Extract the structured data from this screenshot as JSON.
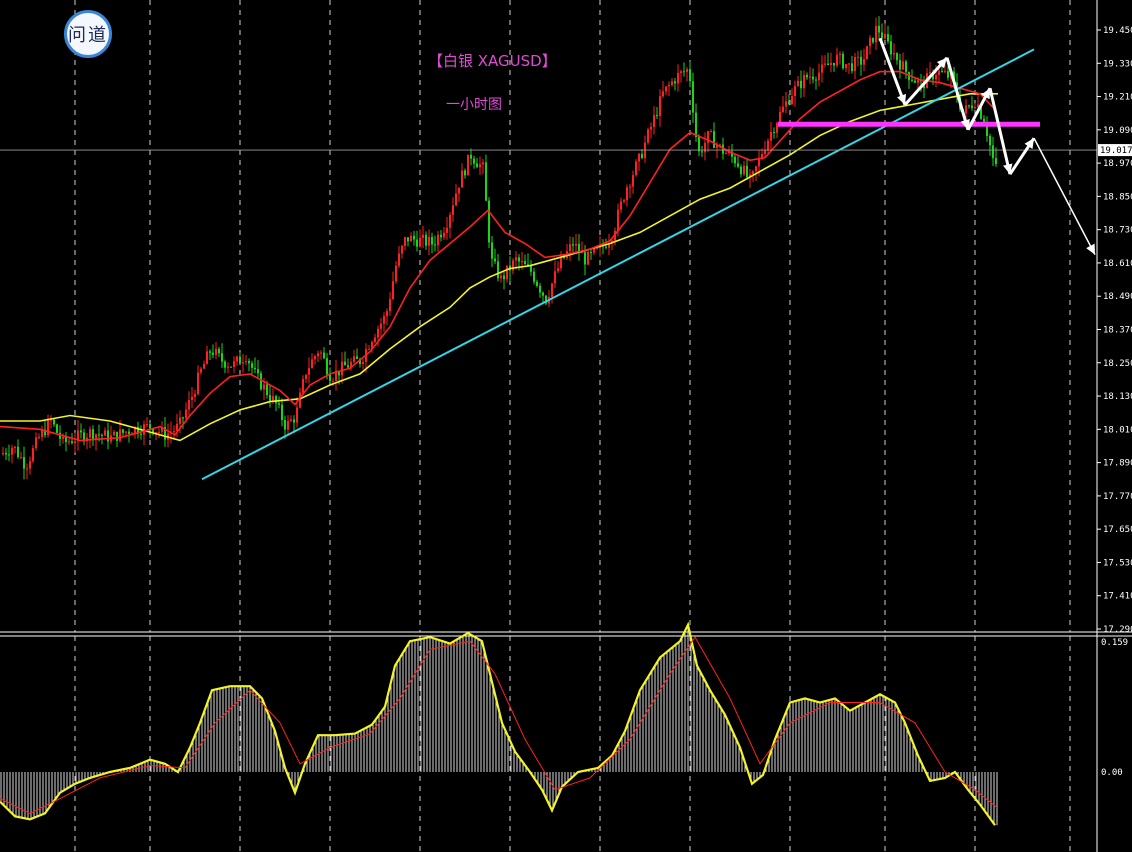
{
  "logo": {
    "text": "问道"
  },
  "chart_data": [
    {
      "type": "candlestick",
      "title": "【白银 XAGUSD】",
      "subtitle": "一小时图",
      "ylim": [
        17.29,
        19.51
      ],
      "yticks": [
        19.45,
        19.33,
        19.21,
        19.09,
        18.97,
        18.85,
        18.73,
        18.61,
        18.49,
        18.37,
        18.25,
        18.13,
        18.01,
        17.89,
        17.77,
        17.65,
        17.53,
        17.41,
        17.29
      ],
      "tick_labels": [
        "19.450",
        "19.330",
        "19.210",
        "19.090",
        "18.970",
        "18.850",
        "18.730",
        "18.610",
        "18.490",
        "18.370",
        "18.250",
        "18.130",
        "18.010",
        "17.890",
        "17.770",
        "17.650",
        "17.530",
        "17.410",
        "17.290"
      ],
      "current_price": 19.017,
      "current_price_label": "19.017",
      "colors": {
        "up": "#ff2020",
        "down": "#19d619",
        "ma_fast": "#ff2020",
        "ma_slow": "#f3f32a",
        "trend": "#33d6e8",
        "support": "#ff33ff",
        "projection": "#ffffff"
      },
      "close_path": [
        [
          0,
          17.92
        ],
        [
          12,
          17.95
        ],
        [
          25,
          17.88
        ],
        [
          38,
          17.98
        ],
        [
          50,
          18.04
        ],
        [
          62,
          17.96
        ],
        [
          75,
          17.98
        ],
        [
          90,
          18.0
        ],
        [
          110,
          17.98
        ],
        [
          130,
          18.01
        ],
        [
          150,
          18.02
        ],
        [
          165,
          17.99
        ],
        [
          178,
          18.02
        ],
        [
          190,
          18.12
        ],
        [
          200,
          18.22
        ],
        [
          210,
          18.3
        ],
        [
          220,
          18.26
        ],
        [
          232,
          18.24
        ],
        [
          245,
          18.28
        ],
        [
          255,
          18.2
        ],
        [
          265,
          18.15
        ],
        [
          275,
          18.1
        ],
        [
          285,
          18.02
        ],
        [
          295,
          18.06
        ],
        [
          305,
          18.22
        ],
        [
          318,
          18.3
        ],
        [
          330,
          18.2
        ],
        [
          345,
          18.24
        ],
        [
          360,
          18.26
        ],
        [
          372,
          18.35
        ],
        [
          385,
          18.42
        ],
        [
          395,
          18.6
        ],
        [
          405,
          18.7
        ],
        [
          420,
          18.69
        ],
        [
          432,
          18.68
        ],
        [
          445,
          18.75
        ],
        [
          458,
          18.9
        ],
        [
          470,
          19.0
        ],
        [
          482,
          18.95
        ],
        [
          490,
          18.62
        ],
        [
          500,
          18.55
        ],
        [
          515,
          18.62
        ],
        [
          530,
          18.58
        ],
        [
          545,
          18.48
        ],
        [
          558,
          18.6
        ],
        [
          572,
          18.68
        ],
        [
          585,
          18.62
        ],
        [
          600,
          18.66
        ],
        [
          612,
          18.72
        ],
        [
          625,
          18.88
        ],
        [
          638,
          18.98
        ],
        [
          650,
          19.1
        ],
        [
          662,
          19.22
        ],
        [
          675,
          19.28
        ],
        [
          688,
          19.31
        ],
        [
          697,
          19.0
        ],
        [
          708,
          19.07
        ],
        [
          720,
          19.02
        ],
        [
          735,
          18.98
        ],
        [
          750,
          18.9
        ],
        [
          762,
          19.02
        ],
        [
          775,
          19.12
        ],
        [
          790,
          19.22
        ],
        [
          805,
          19.28
        ],
        [
          820,
          19.3
        ],
        [
          835,
          19.35
        ],
        [
          848,
          19.32
        ],
        [
          862,
          19.34
        ],
        [
          876,
          19.46
        ],
        [
          890,
          19.38
        ],
        [
          905,
          19.3
        ],
        [
          920,
          19.25
        ],
        [
          935,
          19.3
        ],
        [
          950,
          19.28
        ],
        [
          962,
          19.15
        ],
        [
          975,
          19.2
        ],
        [
          985,
          19.1
        ],
        [
          994,
          18.95
        ]
      ],
      "ma_fast": [
        [
          0,
          18.02
        ],
        [
          40,
          18.01
        ],
        [
          80,
          17.97
        ],
        [
          120,
          17.98
        ],
        [
          160,
          18.02
        ],
        [
          175,
          17.99
        ],
        [
          190,
          18.06
        ],
        [
          210,
          18.14
        ],
        [
          230,
          18.2
        ],
        [
          250,
          18.21
        ],
        [
          265,
          18.18
        ],
        [
          280,
          18.15
        ],
        [
          295,
          18.1
        ],
        [
          310,
          18.17
        ],
        [
          330,
          18.21
        ],
        [
          350,
          18.23
        ],
        [
          370,
          18.29
        ],
        [
          390,
          18.38
        ],
        [
          410,
          18.52
        ],
        [
          430,
          18.62
        ],
        [
          450,
          18.68
        ],
        [
          470,
          18.74
        ],
        [
          488,
          18.8
        ],
        [
          505,
          18.72
        ],
        [
          525,
          18.68
        ],
        [
          545,
          18.63
        ],
        [
          565,
          18.64
        ],
        [
          590,
          18.66
        ],
        [
          610,
          18.69
        ],
        [
          630,
          18.78
        ],
        [
          650,
          18.9
        ],
        [
          670,
          19.02
        ],
        [
          690,
          19.08
        ],
        [
          710,
          19.05
        ],
        [
          730,
          19.01
        ],
        [
          750,
          18.98
        ],
        [
          765,
          18.99
        ],
        [
          780,
          19.05
        ],
        [
          800,
          19.13
        ],
        [
          820,
          19.19
        ],
        [
          840,
          19.23
        ],
        [
          860,
          19.27
        ],
        [
          880,
          19.3
        ],
        [
          900,
          19.3
        ],
        [
          920,
          19.27
        ],
        [
          940,
          19.26
        ],
        [
          960,
          19.24
        ],
        [
          980,
          19.22
        ],
        [
          996,
          19.16
        ]
      ],
      "ma_slow": [
        [
          0,
          18.04
        ],
        [
          40,
          18.04
        ],
        [
          70,
          18.06
        ],
        [
          110,
          18.04
        ],
        [
          150,
          18.0
        ],
        [
          180,
          17.97
        ],
        [
          210,
          18.03
        ],
        [
          240,
          18.08
        ],
        [
          270,
          18.11
        ],
        [
          300,
          18.12
        ],
        [
          330,
          18.17
        ],
        [
          360,
          18.21
        ],
        [
          390,
          18.3
        ],
        [
          420,
          18.38
        ],
        [
          450,
          18.45
        ],
        [
          470,
          18.52
        ],
        [
          490,
          18.56
        ],
        [
          510,
          18.59
        ],
        [
          530,
          18.6
        ],
        [
          550,
          18.62
        ],
        [
          580,
          18.65
        ],
        [
          610,
          18.68
        ],
        [
          640,
          18.72
        ],
        [
          670,
          18.78
        ],
        [
          700,
          18.84
        ],
        [
          730,
          18.88
        ],
        [
          760,
          18.94
        ],
        [
          790,
          19.0
        ],
        [
          820,
          19.07
        ],
        [
          850,
          19.12
        ],
        [
          880,
          19.16
        ],
        [
          910,
          19.18
        ],
        [
          940,
          19.2
        ],
        [
          970,
          19.22
        ],
        [
          998,
          19.22
        ]
      ],
      "trend_line": [
        [
          202,
          17.83
        ],
        [
          1034,
          19.38
        ]
      ],
      "support_level": {
        "price": 19.11,
        "x": [
          778,
          1040
        ]
      },
      "projection_path": [
        [
          880,
          19.42
        ],
        [
          905,
          19.18
        ],
        [
          947,
          19.35
        ],
        [
          968,
          19.09
        ],
        [
          990,
          19.24
        ],
        [
          1010,
          18.93
        ],
        [
          1034,
          19.06
        ],
        [
          1095,
          18.64
        ]
      ],
      "x_gridlines": [
        75,
        150,
        240,
        330,
        420,
        510,
        600,
        690,
        790,
        885,
        975,
        1070
      ]
    },
    {
      "type": "macd",
      "ylim": [
        -0.09,
        0.159
      ],
      "tick_labels": [
        "0.159",
        "0.00"
      ],
      "histogram_path": [
        [
          0,
          -0.05
        ],
        [
          15,
          -0.075
        ],
        [
          30,
          -0.08
        ],
        [
          45,
          -0.07
        ],
        [
          60,
          -0.035
        ],
        [
          75,
          -0.02
        ],
        [
          90,
          -0.01
        ],
        [
          110,
          0.0
        ],
        [
          130,
          0.005
        ],
        [
          150,
          0.015
        ],
        [
          165,
          0.01
        ],
        [
          178,
          0.0
        ],
        [
          190,
          0.03
        ],
        [
          200,
          0.06
        ],
        [
          212,
          0.1
        ],
        [
          230,
          0.105
        ],
        [
          250,
          0.105
        ],
        [
          262,
          0.09
        ],
        [
          275,
          0.05
        ],
        [
          285,
          0.005
        ],
        [
          295,
          -0.035
        ],
        [
          305,
          0.01
        ],
        [
          318,
          0.045
        ],
        [
          335,
          0.045
        ],
        [
          355,
          0.047
        ],
        [
          372,
          0.058
        ],
        [
          385,
          0.08
        ],
        [
          395,
          0.13
        ],
        [
          410,
          0.16
        ],
        [
          430,
          0.165
        ],
        [
          450,
          0.157
        ],
        [
          468,
          0.17
        ],
        [
          482,
          0.16
        ],
        [
          492,
          0.11
        ],
        [
          502,
          0.06
        ],
        [
          515,
          0.025
        ],
        [
          530,
          0.0
        ],
        [
          542,
          -0.03
        ],
        [
          552,
          -0.065
        ],
        [
          562,
          -0.025
        ],
        [
          578,
          0.0
        ],
        [
          598,
          0.005
        ],
        [
          612,
          0.02
        ],
        [
          625,
          0.05
        ],
        [
          640,
          0.1
        ],
        [
          660,
          0.14
        ],
        [
          680,
          0.16
        ],
        [
          688,
          0.18
        ],
        [
          697,
          0.13
        ],
        [
          710,
          0.1
        ],
        [
          725,
          0.07
        ],
        [
          740,
          0.03
        ],
        [
          752,
          -0.02
        ],
        [
          763,
          -0.005
        ],
        [
          775,
          0.04
        ],
        [
          790,
          0.085
        ],
        [
          805,
          0.09
        ],
        [
          820,
          0.085
        ],
        [
          835,
          0.09
        ],
        [
          850,
          0.075
        ],
        [
          865,
          0.085
        ],
        [
          880,
          0.095
        ],
        [
          895,
          0.085
        ],
        [
          905,
          0.06
        ],
        [
          918,
          0.02
        ],
        [
          930,
          -0.015
        ],
        [
          945,
          -0.01
        ],
        [
          955,
          0.0
        ],
        [
          968,
          -0.03
        ],
        [
          980,
          -0.055
        ],
        [
          995,
          -0.09
        ]
      ],
      "signal_path": [
        [
          0,
          -0.045
        ],
        [
          30,
          -0.07
        ],
        [
          60,
          -0.045
        ],
        [
          100,
          -0.01
        ],
        [
          150,
          0.008
        ],
        [
          185,
          0.005
        ],
        [
          215,
          0.06
        ],
        [
          250,
          0.1
        ],
        [
          280,
          0.06
        ],
        [
          300,
          0.01
        ],
        [
          330,
          0.03
        ],
        [
          370,
          0.047
        ],
        [
          400,
          0.09
        ],
        [
          430,
          0.15
        ],
        [
          470,
          0.16
        ],
        [
          495,
          0.12
        ],
        [
          525,
          0.04
        ],
        [
          555,
          -0.03
        ],
        [
          590,
          -0.01
        ],
        [
          630,
          0.04
        ],
        [
          670,
          0.12
        ],
        [
          695,
          0.165
        ],
        [
          730,
          0.09
        ],
        [
          760,
          0.01
        ],
        [
          790,
          0.06
        ],
        [
          830,
          0.085
        ],
        [
          880,
          0.085
        ],
        [
          915,
          0.06
        ],
        [
          945,
          0.0
        ],
        [
          975,
          -0.03
        ],
        [
          997,
          -0.06
        ]
      ]
    }
  ]
}
